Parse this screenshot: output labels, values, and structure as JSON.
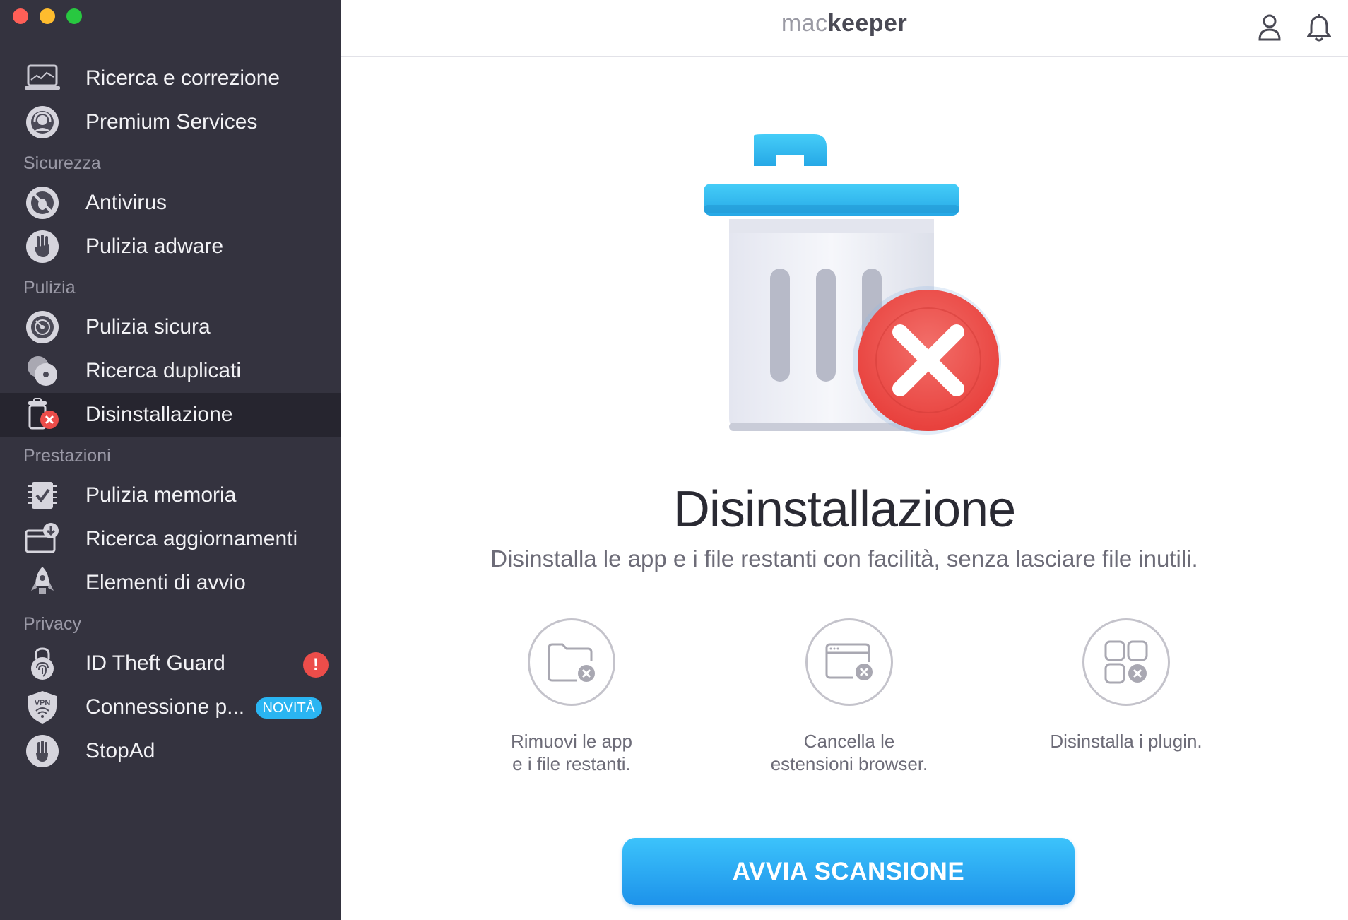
{
  "app": {
    "logo_mac": "mac",
    "logo_keeper": "keeper"
  },
  "sidebar": {
    "top_items": [
      {
        "label": "Ricerca e correzione",
        "icon": "laptop-chart-icon"
      },
      {
        "label": "Premium Services",
        "icon": "headset-icon"
      }
    ],
    "sections": [
      {
        "title": "Sicurezza",
        "items": [
          {
            "label": "Antivirus",
            "icon": "bug-blocked-icon"
          },
          {
            "label": "Pulizia adware",
            "icon": "hand-stop-icon"
          }
        ]
      },
      {
        "title": "Pulizia",
        "items": [
          {
            "label": "Pulizia sicura",
            "icon": "disk-clean-icon"
          },
          {
            "label": "Ricerca duplicati",
            "icon": "duplicate-discs-icon"
          },
          {
            "label": "Disinstallazione",
            "icon": "trash-x-icon",
            "active": true
          }
        ]
      },
      {
        "title": "Prestazioni",
        "items": [
          {
            "label": "Pulizia memoria",
            "icon": "memory-chip-icon"
          },
          {
            "label": "Ricerca aggiornamenti",
            "icon": "update-download-icon"
          },
          {
            "label": "Elementi di avvio",
            "icon": "rocket-icon"
          }
        ]
      },
      {
        "title": "Privacy",
        "items": [
          {
            "label": "ID Theft Guard",
            "icon": "fingerprint-lock-icon",
            "badge": "!"
          },
          {
            "label": "Connessione p...",
            "icon": "vpn-shield-icon",
            "tag": "NOVITÀ"
          },
          {
            "label": "StopAd",
            "icon": "stopad-hand-icon"
          }
        ]
      }
    ]
  },
  "main": {
    "title": "Disinstallazione",
    "subtitle": "Disinstalla le app e i file restanti con facilità, senza lasciare file inutili.",
    "features": [
      {
        "text": "Rimuovi le app e i file restanti.",
        "icon": "folder-x-icon"
      },
      {
        "text": "Cancella le estensioni browser.",
        "icon": "browser-x-icon"
      },
      {
        "text": "Disinstalla i plugin.",
        "icon": "grid-x-icon"
      }
    ],
    "scan_button": "AVVIA SCANSIONE"
  },
  "colors": {
    "sidebar_bg": "#34333f",
    "active_bg": "#26252f",
    "accent": "#2ab5f2",
    "alert": "#ec4d4a"
  }
}
